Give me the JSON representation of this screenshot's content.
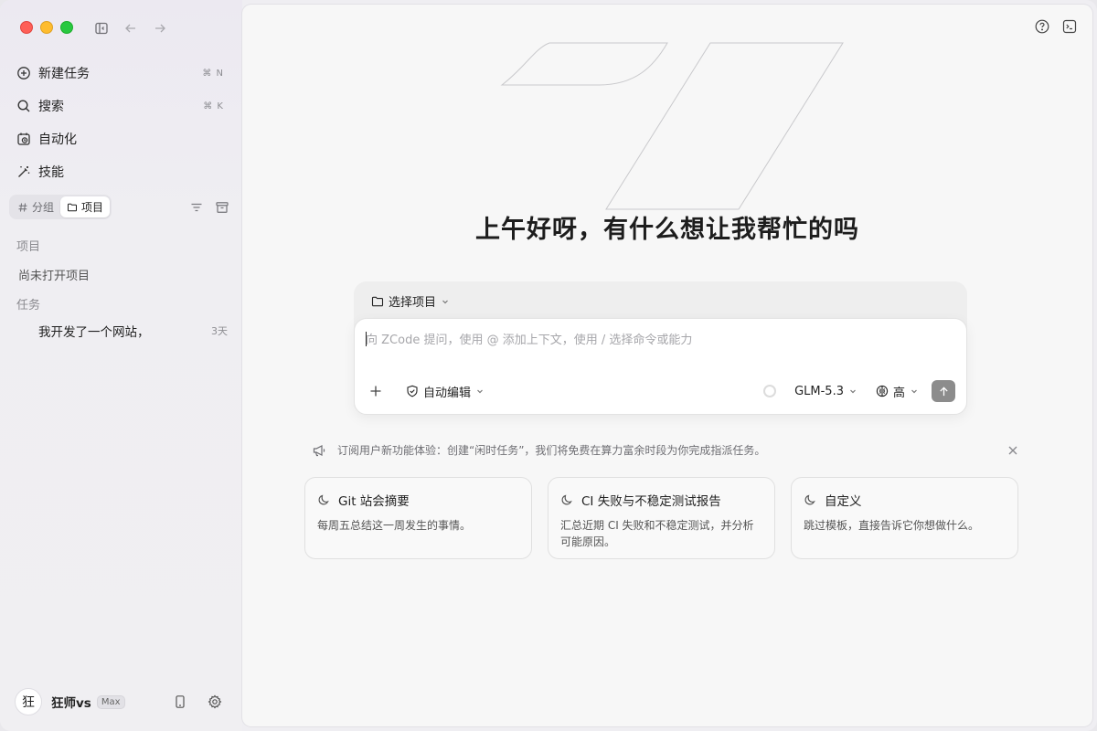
{
  "sidebar": {
    "nav": [
      {
        "label": "新建任务",
        "shortcut": "⌘ N",
        "icon": "new-task-icon"
      },
      {
        "label": "搜索",
        "shortcut": "⌘ K",
        "icon": "search-icon"
      },
      {
        "label": "自动化",
        "shortcut": "",
        "icon": "automation-clock-icon"
      },
      {
        "label": "技能",
        "shortcut": "",
        "icon": "magic-wand-icon"
      }
    ],
    "segments": [
      {
        "label": "分组",
        "icon": "hash-icon",
        "active": false
      },
      {
        "label": "项目",
        "icon": "folder-icon",
        "active": true
      }
    ],
    "projects_label": "项目",
    "projects_empty": "尚未打开项目",
    "tasks_label": "任务",
    "tasks": [
      {
        "title": "我开发了一个网站，",
        "age": "3天"
      }
    ],
    "user": {
      "avatar_text": "狂",
      "name": "狂师vs",
      "plan": "Max"
    }
  },
  "main": {
    "greeting": "上午好呀，有什么想让我帮忙的吗",
    "composer": {
      "project_picker": "选择项目",
      "placeholder": "向 ZCode 提问，使用 @ 添加上下文，使用 / 选择命令或能力",
      "mode": "自动编辑",
      "model": "GLM-5.3",
      "effort": "高"
    },
    "notice": "订阅用户新功能体验：创建“闲时任务”，我们将免费在算力富余时段为你完成指派任务。",
    "cards": [
      {
        "title": "Git 站会摘要",
        "desc": "每周五总结这一周发生的事情。"
      },
      {
        "title": "CI 失败与不稳定测试报告",
        "desc": "汇总近期 CI 失败和不稳定测试，并分析可能原因。"
      },
      {
        "title": "自定义",
        "desc": "跳过模板，直接告诉它你想做什么。"
      }
    ]
  },
  "colors": {
    "close": "#fe5f57",
    "minimize": "#febc2e",
    "zoom": "#28c840",
    "send_button": "#8c8c8c"
  }
}
